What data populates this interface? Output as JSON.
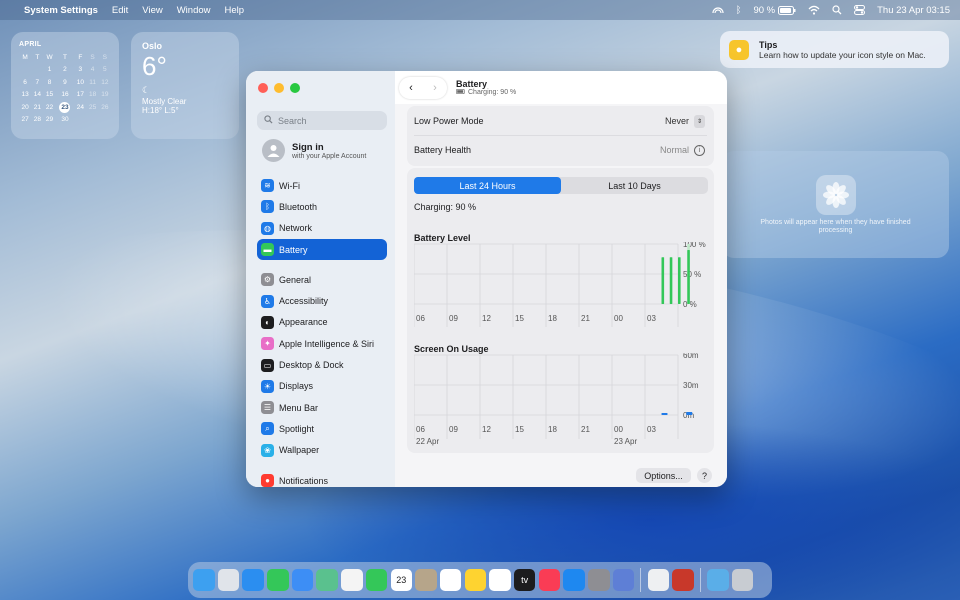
{
  "menubar": {
    "app": "System Settings",
    "items": [
      "Edit",
      "View",
      "Window",
      "Help"
    ],
    "battery_percent": "90 %",
    "datetime": "Thu 23 Apr  03:15"
  },
  "calendar": {
    "month": "APRIL",
    "headers": [
      "M",
      "T",
      "W",
      "T",
      "F",
      "S",
      "S"
    ],
    "weeks": [
      [
        "",
        "",
        "1",
        "2",
        "3",
        "4",
        "5"
      ],
      [
        "6",
        "7",
        "8",
        "9",
        "10",
        "11",
        "12"
      ],
      [
        "13",
        "14",
        "15",
        "16",
        "17",
        "18",
        "19"
      ],
      [
        "20",
        "21",
        "22",
        "23",
        "24",
        "25",
        "26"
      ],
      [
        "27",
        "28",
        "29",
        "30",
        "",
        "",
        ""
      ]
    ],
    "today": "23"
  },
  "weather": {
    "city": "Oslo",
    "temp": "6°",
    "condition": "Mostly Clear",
    "hilo": "H:18° L:5°"
  },
  "tips": {
    "title": "Tips",
    "text": "Learn how to update your icon style on Mac."
  },
  "photos": {
    "text": "Photos will appear here when they have finished processing"
  },
  "sidebar": {
    "search_placeholder": "Search",
    "signin_title": "Sign in",
    "signin_sub": "with your Apple Account",
    "items": [
      {
        "label": "Wi-Fi",
        "color": "#1f7ae8",
        "icon": "wifi-icon",
        "glyph": "≋"
      },
      {
        "label": "Bluetooth",
        "color": "#1f7ae8",
        "icon": "bluetooth-icon",
        "glyph": "ᛒ"
      },
      {
        "label": "Network",
        "color": "#1f7ae8",
        "icon": "network-icon",
        "glyph": "◍"
      },
      {
        "label": "Battery",
        "color": "#33c759",
        "icon": "battery-icon",
        "glyph": "▬",
        "selected": true
      },
      {
        "label": "General",
        "color": "#8e8e93",
        "icon": "gear-icon",
        "glyph": "⚙",
        "gap": true
      },
      {
        "label": "Accessibility",
        "color": "#1f7ae8",
        "icon": "accessibility-icon",
        "glyph": "♿"
      },
      {
        "label": "Appearance",
        "color": "#1d1d1f",
        "icon": "appearance-icon",
        "glyph": "◐"
      },
      {
        "label": "Apple Intelligence & Siri",
        "color": "#e86ec7",
        "icon": "siri-icon",
        "glyph": "✦"
      },
      {
        "label": "Desktop & Dock",
        "color": "#1d1d1f",
        "icon": "desktop-dock-icon",
        "glyph": "▭"
      },
      {
        "label": "Displays",
        "color": "#1f7ae8",
        "icon": "displays-icon",
        "glyph": "☀"
      },
      {
        "label": "Menu Bar",
        "color": "#8e8e93",
        "icon": "menu-bar-icon",
        "glyph": "☰"
      },
      {
        "label": "Spotlight",
        "color": "#1f7ae8",
        "icon": "spotlight-icon",
        "glyph": "⌕"
      },
      {
        "label": "Wallpaper",
        "color": "#2ab0e8",
        "icon": "wallpaper-icon",
        "glyph": "❀"
      },
      {
        "label": "Notifications",
        "color": "#ff3b30",
        "icon": "notifications-icon",
        "glyph": "●",
        "gap": true
      }
    ]
  },
  "header": {
    "title": "Battery",
    "subtitle": "Charging: 90 %"
  },
  "settings": {
    "low_power_label": "Low Power Mode",
    "low_power_value": "Never",
    "health_label": "Battery Health",
    "health_value": "Normal"
  },
  "segmented": {
    "left": "Last 24 Hours",
    "right": "Last 10 Days"
  },
  "charging_status": "Charging: 90 %",
  "chart_data": [
    {
      "type": "bar",
      "title": "Battery Level",
      "x_ticks": [
        "06",
        "09",
        "12",
        "15",
        "18",
        "21",
        "00",
        "03"
      ],
      "y_ticks": [
        "100 %",
        "50 %",
        "0 %"
      ],
      "ylim": [
        0,
        100
      ],
      "bars": [
        {
          "x": 2.0,
          "value": 78
        },
        {
          "x": 2.25,
          "value": 78
        },
        {
          "x": 2.5,
          "value": 78
        },
        {
          "x": 2.75,
          "value": 90
        }
      ],
      "color": "#33c759"
    },
    {
      "type": "bar",
      "title": "Screen On Usage",
      "x_ticks": [
        "06",
        "09",
        "12",
        "15",
        "18",
        "21",
        "00",
        "03"
      ],
      "y_ticks": [
        "60m",
        "30m",
        "0m"
      ],
      "ylim": [
        0,
        60
      ],
      "date_labels": [
        "22 Apr",
        "23 Apr"
      ],
      "bars": [
        {
          "x": 2.0,
          "value": 1
        },
        {
          "x": 2.75,
          "value": 3
        }
      ],
      "color": "#1f7ae8"
    }
  ],
  "buttons": {
    "options": "Options...",
    "help": "?"
  },
  "dock": [
    {
      "name": "finder",
      "color": "#3da0f0"
    },
    {
      "name": "launchpad",
      "color": "#e0e4ea"
    },
    {
      "name": "safari",
      "color": "#2b8ef0"
    },
    {
      "name": "messages",
      "color": "#34c759"
    },
    {
      "name": "mail",
      "color": "#3d8ef5"
    },
    {
      "name": "maps",
      "color": "#5ac18e"
    },
    {
      "name": "photos",
      "color": "#f4f4f4"
    },
    {
      "name": "facetime",
      "color": "#34c759"
    },
    {
      "name": "calendar",
      "color": "#ffffff",
      "text": "23"
    },
    {
      "name": "contacts",
      "color": "#b6a58a"
    },
    {
      "name": "reminders",
      "color": "#ffffff"
    },
    {
      "name": "notes",
      "color": "#fed330"
    },
    {
      "name": "freeform",
      "color": "#ffffff"
    },
    {
      "name": "tv",
      "color": "#1c1c1e",
      "text": "tv"
    },
    {
      "name": "music",
      "color": "#fa3c55"
    },
    {
      "name": "app-store",
      "color": "#1e88f0"
    },
    {
      "name": "system-settings",
      "color": "#8e8e93"
    },
    {
      "name": "iphone-mirroring",
      "color": "#5e7fd6"
    },
    {
      "name": "sep"
    },
    {
      "name": "preview",
      "color": "#eef0f2"
    },
    {
      "name": "photo-booth",
      "color": "#c8382a"
    },
    {
      "name": "sep"
    },
    {
      "name": "downloads-folder",
      "color": "#5aaee8"
    },
    {
      "name": "trash",
      "color": "#c8ccd2"
    }
  ]
}
